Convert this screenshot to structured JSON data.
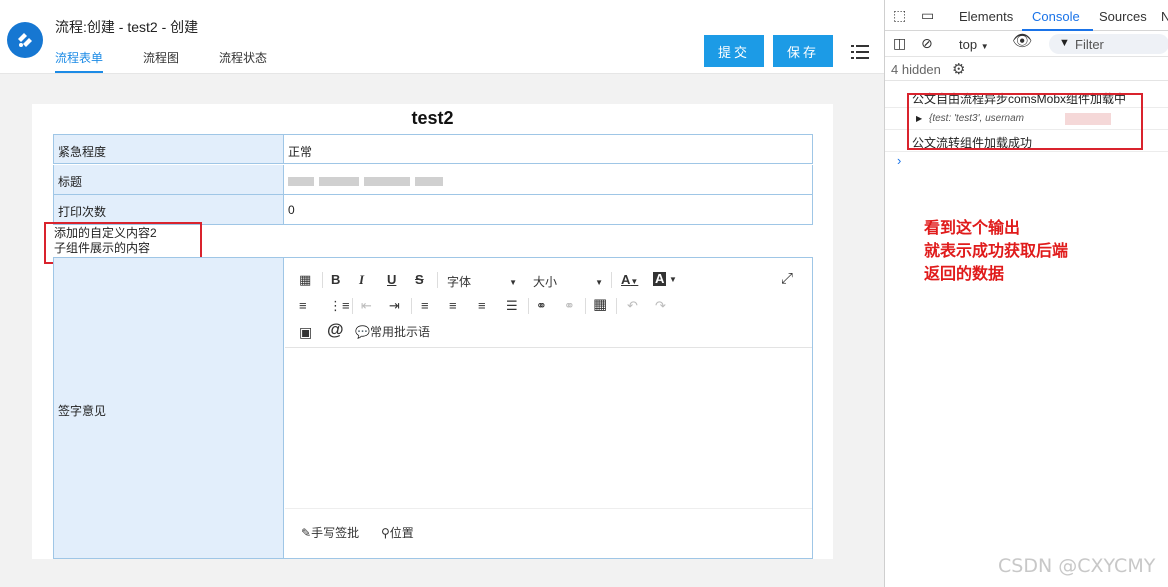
{
  "app": {
    "title": "流程:创建 - test2 - 创建",
    "tabs": [
      {
        "label": "流程表单",
        "active": true
      },
      {
        "label": "流程图",
        "active": false
      },
      {
        "label": "流程状态",
        "active": false
      }
    ],
    "submit_label": "提交",
    "save_label": "保存",
    "accent_color": "#1c9be6"
  },
  "form": {
    "title": "test2",
    "rows": [
      {
        "label": "紧急程度",
        "value": "正常"
      },
      {
        "label": "标题",
        "value": ""
      },
      {
        "label": "打印次数",
        "value": "0"
      }
    ],
    "custom_lines": [
      "添加的自定义内容2",
      "子组件展示的内容"
    ],
    "opinion_label": "签字意见",
    "editor": {
      "font_select": "字体",
      "size_select": "大小",
      "comment_phrases_label": "常用批示语",
      "handwrite_label": "手写签批",
      "location_label": "位置"
    }
  },
  "devtools": {
    "tabs": [
      "Elements",
      "Console",
      "Sources",
      "N"
    ],
    "active_tab": "Console",
    "context": "top",
    "filter_placeholder": "Filter",
    "hidden_count": "4 hidden",
    "console_lines": [
      "公文自由流程异步comsMobx组件加载中",
      "{test: 'test3', usernam",
      "公文流转组件加载成功"
    ]
  },
  "annotation": [
    "看到这个输出",
    "就表示成功获取后端",
    "返回的数据"
  ],
  "watermark": "CSDN @CXYCMY"
}
